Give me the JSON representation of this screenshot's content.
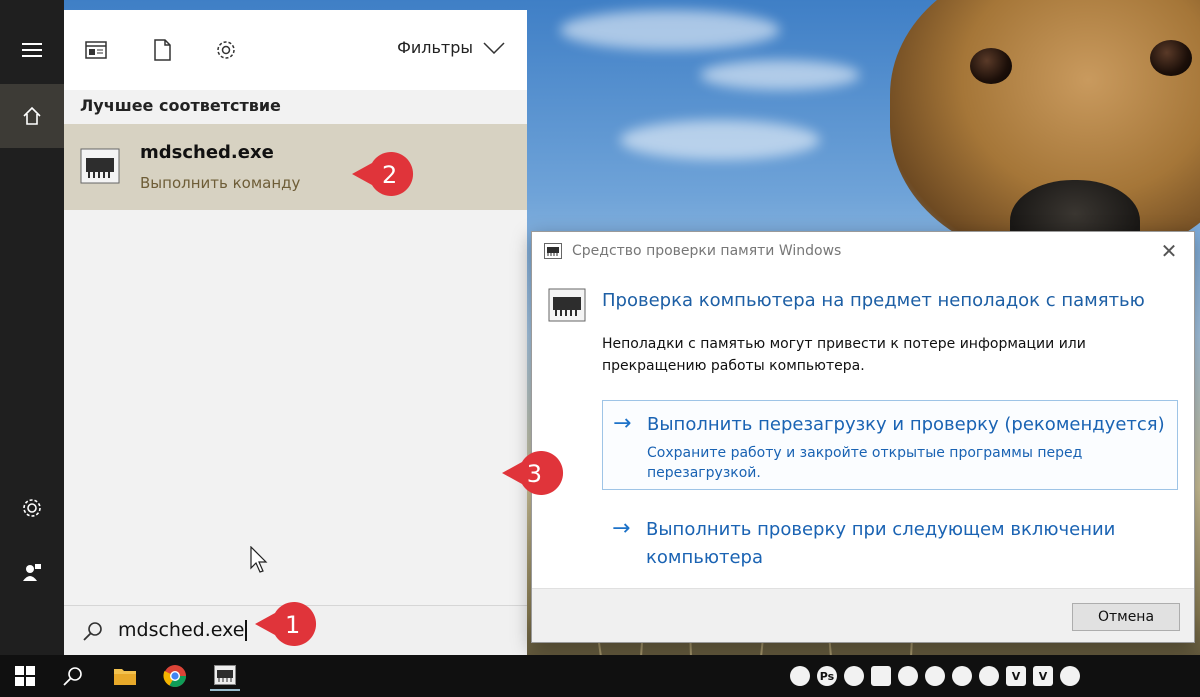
{
  "search_panel": {
    "filters_label": "Фильтры",
    "best_match_header": "Лучшее соответствие",
    "result": {
      "title": "mdsched.exe",
      "subtitle": "Выполнить команду"
    },
    "search_query": "mdsched.exe",
    "icons": {
      "document_view": "document-view-icon",
      "file": "file-icon",
      "settings": "gear-icon",
      "chevron": "chevron-down-icon",
      "search": "search-icon"
    }
  },
  "rail": {
    "items": [
      "hamburger-menu-icon",
      "home-icon",
      "gear-icon",
      "user-feedback-icon"
    ]
  },
  "badges": [
    "1",
    "2",
    "3"
  ],
  "dialog": {
    "title": "Средство проверки памяти Windows",
    "heading": "Проверка компьютера на предмет неполадок с памятью",
    "text": "Неполадки с памятью могут привести к потере информации или прекращению работы компьютера.",
    "option1": {
      "main": "Выполнить перезагрузку и проверку (рекомендуется)",
      "desc": "Сохраните работу и закройте открытые программы перед перезагрузкой."
    },
    "option2": {
      "main": "Выполнить проверку при следующем включении компьютера"
    },
    "cancel_label": "Отмена",
    "arrow": "→"
  },
  "taskbar": {
    "tray_labels": [
      "",
      "Ps",
      "",
      "",
      "",
      "",
      "",
      "",
      "V",
      ""
    ]
  },
  "colors": {
    "accent": "#1a63b3",
    "badge": "#e0343a",
    "result_bg": "#d7d2c2",
    "rail_bg": "#1f1f1f"
  }
}
